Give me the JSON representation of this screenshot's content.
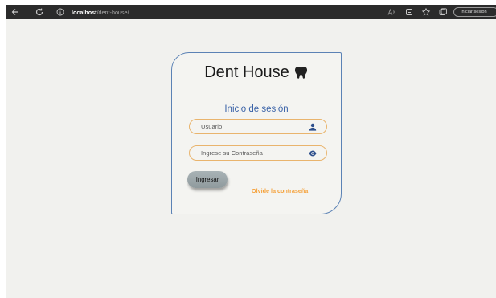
{
  "browser": {
    "url_host": "localhost",
    "url_path": "/dent-house/",
    "signin_label": "Iniciar sesión"
  },
  "card": {
    "brand": "Dent House",
    "title": "Inicio de sesión",
    "username_placeholder": "Usuario",
    "password_placeholder": "Ingrese su Contraseña",
    "submit_label": "Ingresar",
    "forgot_label": "Olvide la contraseña"
  },
  "colors": {
    "card_border": "#5b82b5",
    "field_border": "#e9b46d",
    "title": "#3b63a8",
    "forgot_link": "#f5a13a",
    "icon": "#2d4f8c"
  }
}
